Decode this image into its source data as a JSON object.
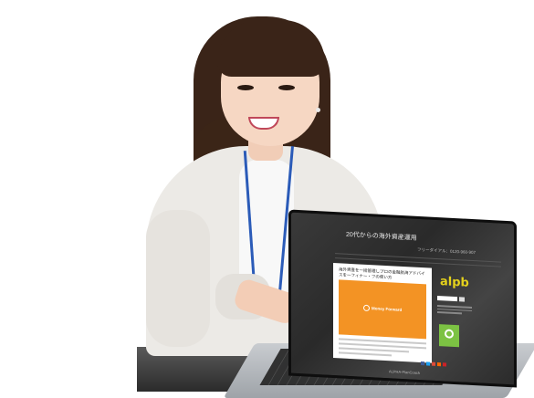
{
  "laptop": {
    "site_title": "20代からの海外資産運用",
    "site_contact": "フリーダイアル：0120-960-907",
    "article_title": "海外資産を一括管理しプロの金融航海アドバイスを一フィナー・フの使い方",
    "brand_logo": "Money Forward",
    "sidebar_logo": "alpb",
    "laptop_brand": "ALPHA-PlanCoach"
  },
  "colors": {
    "article_image": "#f39324",
    "sidebar_logo": "#e5d21c",
    "badge": "#7cc243",
    "lanyard": "#2b5bb8"
  }
}
